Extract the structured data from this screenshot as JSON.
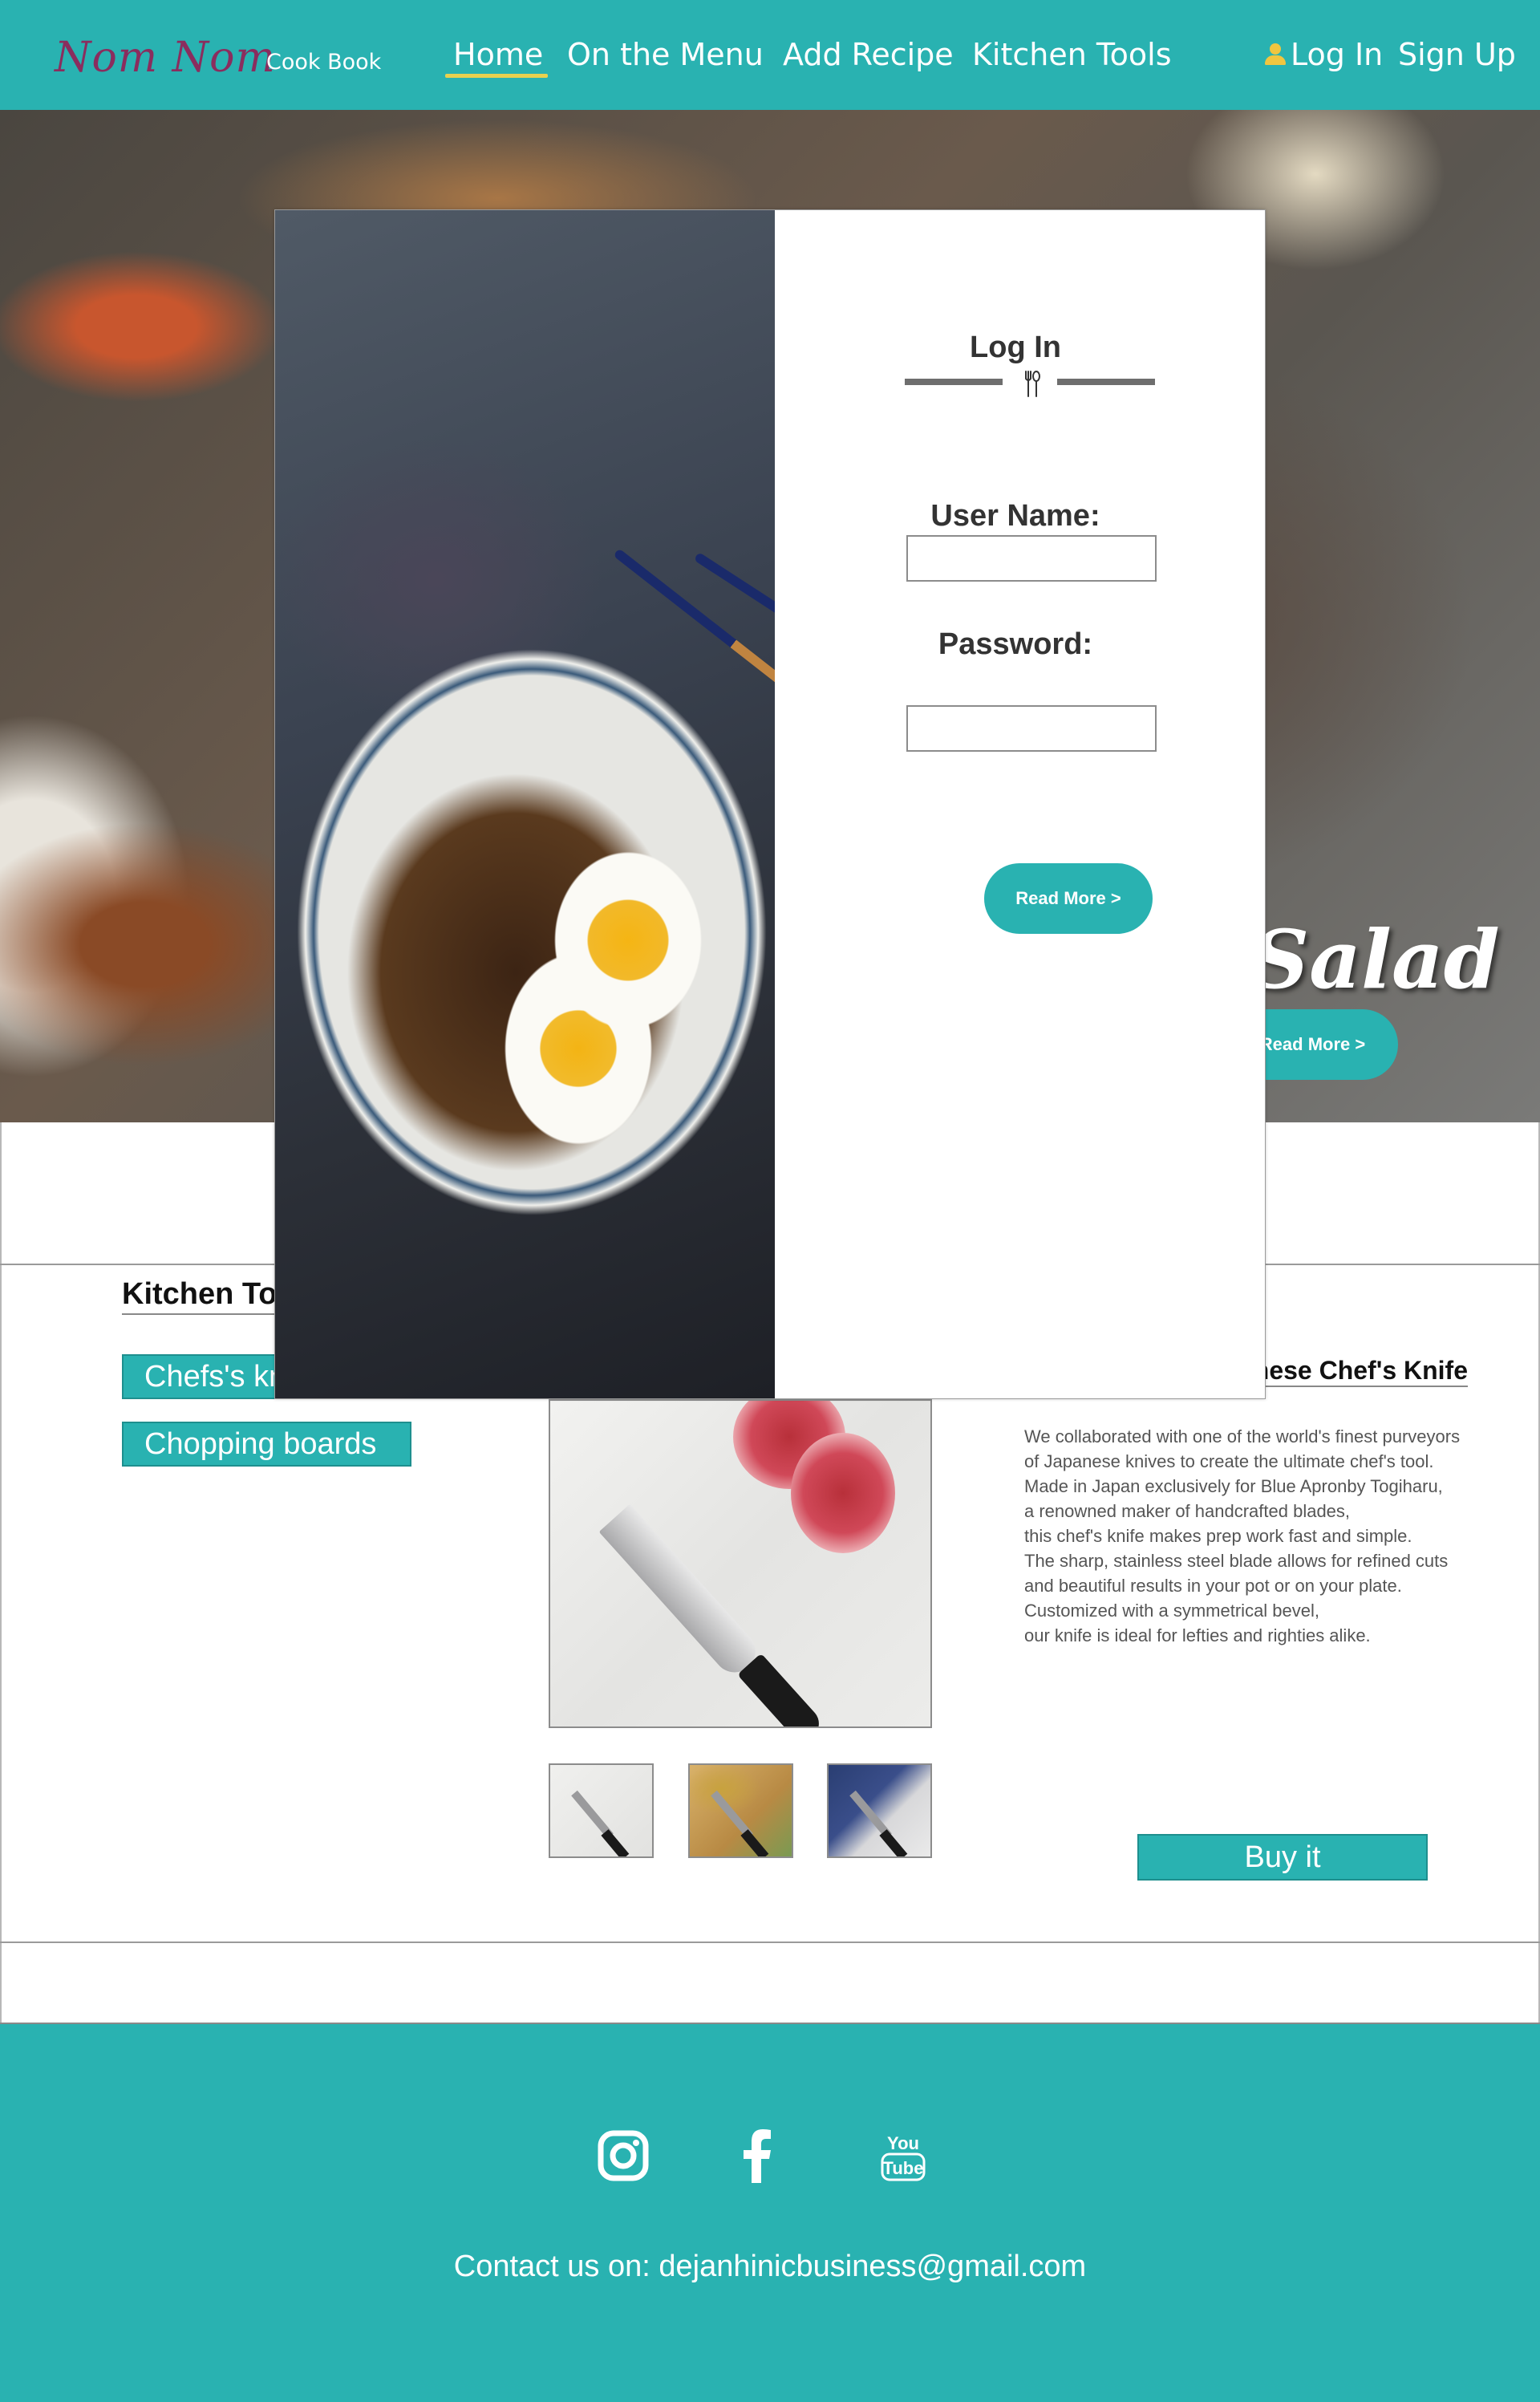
{
  "header": {
    "brand": "Nom Nom",
    "brand_sub": "Cook Book",
    "nav": {
      "home": "Home",
      "menu": "On the Menu",
      "add": "Add Recipe",
      "tools": "Kitchen Tools"
    },
    "login": "Log In",
    "signup": "Sign Up"
  },
  "hero": {
    "title": "Salad",
    "button": "Read More >"
  },
  "modal": {
    "title": "Log In",
    "username_label": "User Name:",
    "password_label": "Password:",
    "username_value": "",
    "password_value": "",
    "button": "Read More >"
  },
  "kitchen": {
    "heading": "Kitchen Tools",
    "tabs": [
      "Chefs's knives",
      "Chopping boards"
    ],
    "product": {
      "title": "Japanese Chef's Knife",
      "description": [
        "We collaborated with one of the world's finest purveyors",
        " of Japanese knives to create the ultimate chef's tool.",
        " Made in Japan exclusively for Blue Apronby Togiharu,",
        " a renowned maker of handcrafted blades,",
        " this chef's knife makes prep work fast and simple.",
        " The sharp, stainless steel blade allows for refined cuts",
        " and beautiful results in your pot or on your plate.",
        "Customized with a symmetrical bevel,",
        " our knife is ideal for lefties and righties alike."
      ],
      "buy_label": "Buy it"
    }
  },
  "footer": {
    "contact": "Contact us on: dejanhinicbusiness@gmail.com",
    "social": [
      "instagram-icon",
      "facebook-icon",
      "youtube-icon"
    ],
    "youtube_text_top": "You",
    "youtube_text_bottom": "Tube"
  },
  "colors": {
    "accent": "#29b2b1",
    "brand": "#8a2d5e",
    "underline": "#e7d14f",
    "user_icon": "#f0c640"
  }
}
